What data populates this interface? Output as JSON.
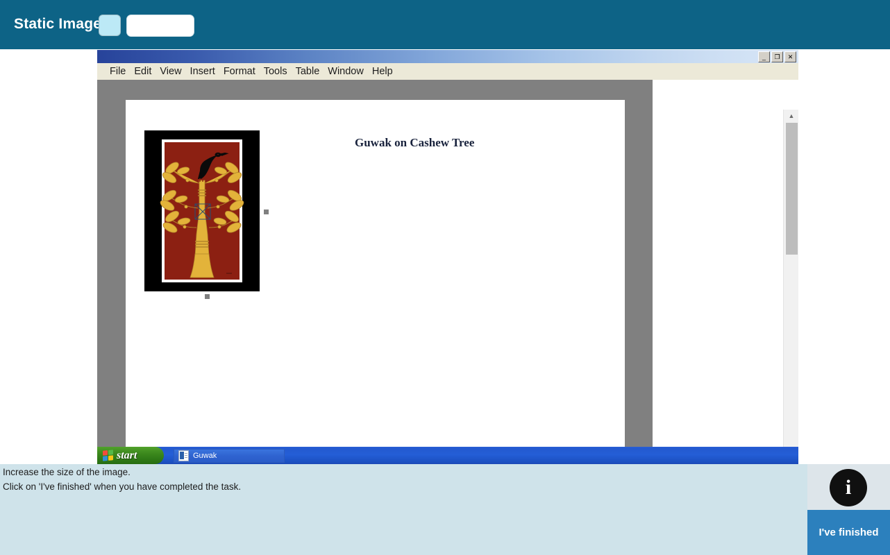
{
  "header": {
    "title": "Static Image",
    "slot_blue": "",
    "slot_white": ""
  },
  "os_window": {
    "title_bar": {
      "title": ""
    },
    "window_buttons": [
      {
        "name": "minimize",
        "glyph": "_"
      },
      {
        "name": "restore",
        "glyph": "❐"
      },
      {
        "name": "close",
        "glyph": "✕"
      }
    ],
    "menu": [
      "File",
      "Edit",
      "View",
      "Insert",
      "Format",
      "Tools",
      "Table",
      "Window",
      "Help"
    ],
    "document": {
      "heading": "Guwak on Cashew Tree",
      "image_alt": "Guwak bird perched on a stylised golden cashew tree, dark red panel with white and black border",
      "image_selected": true,
      "selection_handles": [
        "middle-right",
        "bottom-center"
      ]
    },
    "scrollbar": {
      "up_arrow": "▲",
      "down_arrow": "▼",
      "thumb_position": "top"
    },
    "taskbar": {
      "start_label": "start",
      "tasks": [
        {
          "label": "Guwak",
          "icon": "word-document-icon"
        }
      ]
    }
  },
  "instructions": {
    "line1": "Increase the size of the image.",
    "line2": "Click on 'I've finished' when you have completed the task."
  },
  "footer": {
    "info_icon_glyph": "i",
    "finish_label": "I've finished"
  },
  "colors": {
    "header_blue": "#0d6386",
    "instruction_bg": "#cfe3ea",
    "finish_button": "#2c80bd",
    "workspace_gray": "#808080",
    "artwork_red": "#8c2012",
    "artwork_gold": "#e3b33a"
  }
}
